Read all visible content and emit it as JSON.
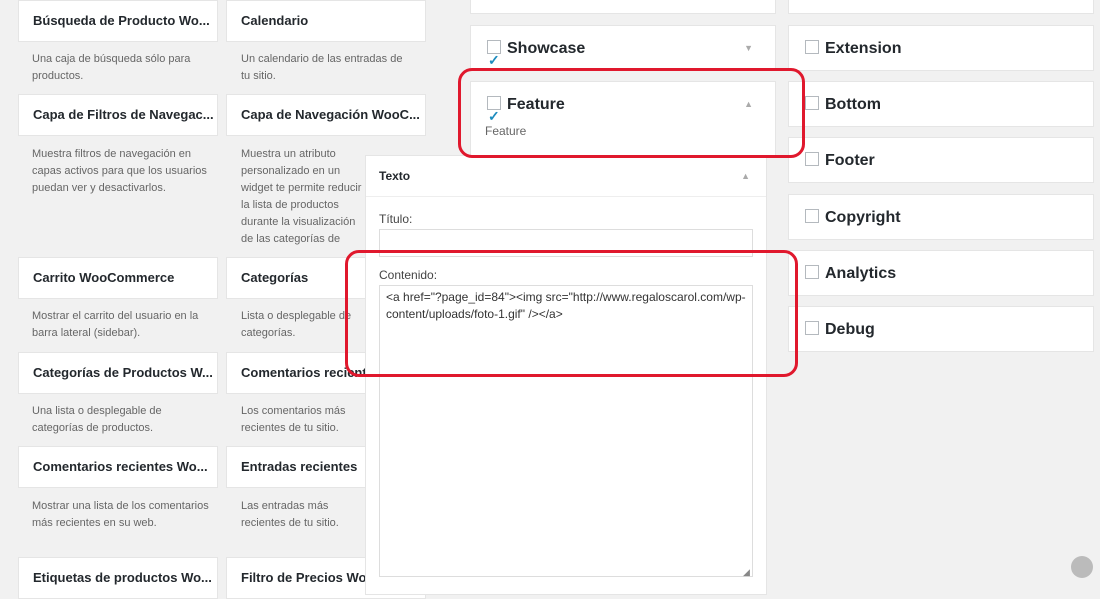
{
  "widgets": [
    {
      "title": "Búsqueda de Producto Wo...",
      "desc": "Una caja de búsqueda sólo para productos."
    },
    {
      "title": "Calendario",
      "desc": "Un calendario de las entradas de tu sitio."
    },
    {
      "title": "Capa de Filtros de Navegac...",
      "desc": "Muestra filtros de navegación en capas activos para que los usuarios puedan ver y desactivarlos."
    },
    {
      "title": "Capa de Navegación WooC...",
      "desc": "Muestra un atributo personalizado en un widget te permite reducir la lista de productos durante la visualización de las categorías de productos."
    },
    {
      "title": "Carrito WooCommerce",
      "desc": "Mostrar el carrito del usuario en la barra lateral (sidebar)."
    },
    {
      "title": "Categorías",
      "desc": "Lista o desplegable de categorías."
    },
    {
      "title": "Categorías de Productos W...",
      "desc": "Una lista o desplegable de categorías de productos."
    },
    {
      "title": "Comentarios recientes",
      "desc": "Los comentarios más recientes de tu sitio."
    },
    {
      "title": "Comentarios recientes Wo...",
      "desc": "Mostrar una lista de los comentarios más recientes en su web."
    },
    {
      "title": "Entradas recientes",
      "desc": "Las entradas más recientes de tu sitio."
    },
    {
      "title": "Etiquetas de productos Wo...",
      "desc": ""
    },
    {
      "title": "Filtro de Precios Woo",
      "desc": ""
    }
  ],
  "middle_areas": [
    {
      "label": "Showcase",
      "checked": true
    },
    {
      "label": "Feature",
      "checked": true,
      "subtitle": "Feature"
    }
  ],
  "right_areas": [
    {
      "label": "Extension",
      "checked": false
    },
    {
      "label": "Bottom",
      "checked": false
    },
    {
      "label": "Footer",
      "checked": false
    },
    {
      "label": "Copyright",
      "checked": false
    },
    {
      "label": "Analytics",
      "checked": false
    },
    {
      "label": "Debug",
      "checked": false
    }
  ],
  "text_widget": {
    "header": "Texto",
    "title_label": "Título:",
    "title_value": "",
    "content_label": "Contenido:",
    "content_value": "<a href=\"?page_id=84\"><img src=\"http://www.regaloscarol.com/wp-content/uploads/foto-1.gif\" /></a>"
  },
  "colors": {
    "highlight": "#e0182d",
    "checkmark": "#1e8cbe"
  }
}
